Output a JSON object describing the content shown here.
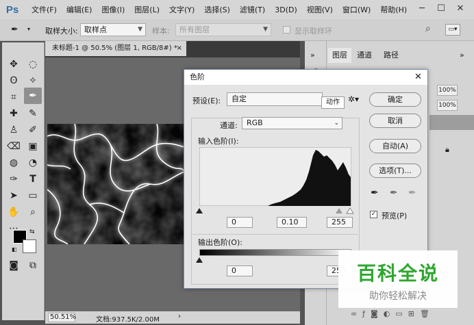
{
  "menubar": {
    "logo": "Ps",
    "items": [
      "文件(F)",
      "编辑(E)",
      "图像(I)",
      "图层(L)",
      "文字(Y)",
      "选择(S)",
      "滤镜(T)",
      "3D(D)",
      "视图(V)",
      "窗口(W)",
      "帮助(H)"
    ]
  },
  "options": {
    "sample_size_label": "取样大小:",
    "sample_size_value": "取样点",
    "sample_label": "样本:",
    "sample_value": "所有图层",
    "show_ring_label": "显示取样环"
  },
  "document": {
    "tab_title": "未标题-1 @ 50.5% (图层 1, RGB/8#) *",
    "zoom": "50.51%",
    "doc_info": "文档:937.5K/2.00M"
  },
  "panels": {
    "tabs": [
      "图层",
      "通道",
      "路径"
    ],
    "opacity": "100%",
    "fill": "100%"
  },
  "dialog": {
    "title": "色阶",
    "preset_label": "预设(E):",
    "preset_value": "自定",
    "preset_tooltip": "动作",
    "channel_label": "通道:",
    "channel_value": "RGB",
    "input_levels_label": "输入色阶(I):",
    "input_black": "0",
    "input_gamma": "0.10",
    "input_white": "255",
    "output_levels_label": "输出色阶(O):",
    "output_black": "0",
    "output_white": "255",
    "ok": "确定",
    "cancel": "取消",
    "auto": "自动(A)",
    "options": "选项(T)...",
    "preview_label": "预览(P)",
    "preview_checked": true
  },
  "watermark": {
    "title": "百科全说",
    "subtitle": "助你轻松解决",
    "color": "#2ea62e"
  }
}
